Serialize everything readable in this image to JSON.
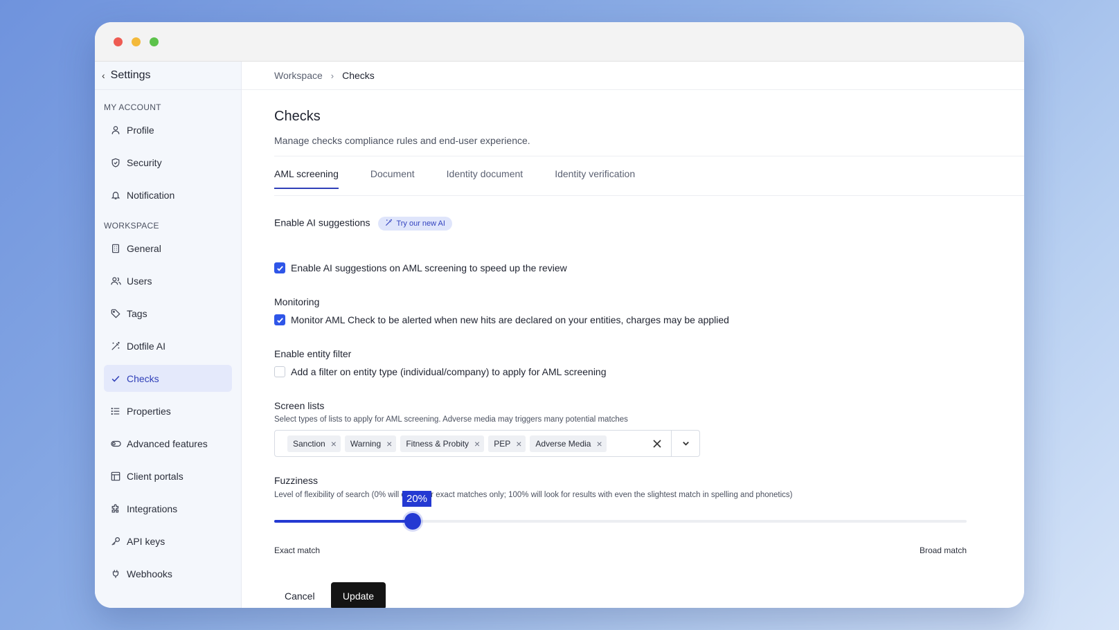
{
  "sidebar": {
    "back_label": "Settings",
    "sections": [
      {
        "title": "MY ACCOUNT",
        "items": [
          {
            "label": "Profile",
            "icon": "user-icon"
          },
          {
            "label": "Security",
            "icon": "shield-icon"
          },
          {
            "label": "Notification",
            "icon": "bell-icon"
          }
        ]
      },
      {
        "title": "WORKSPACE",
        "items": [
          {
            "label": "General",
            "icon": "building-icon"
          },
          {
            "label": "Users",
            "icon": "users-icon"
          },
          {
            "label": "Tags",
            "icon": "tag-icon"
          },
          {
            "label": "Dotfile AI",
            "icon": "magic-wand-icon"
          },
          {
            "label": "Checks",
            "icon": "check-icon",
            "active": true
          },
          {
            "label": "Properties",
            "icon": "list-icon"
          },
          {
            "label": "Advanced features",
            "icon": "toggle-icon"
          },
          {
            "label": "Client portals",
            "icon": "layout-icon"
          },
          {
            "label": "Integrations",
            "icon": "puzzle-icon"
          },
          {
            "label": "API keys",
            "icon": "key-icon"
          },
          {
            "label": "Webhooks",
            "icon": "plug-icon"
          }
        ]
      }
    ]
  },
  "breadcrumb": {
    "parent": "Workspace",
    "current": "Checks"
  },
  "page": {
    "title": "Checks",
    "subtitle": "Manage checks compliance rules and end-user experience."
  },
  "tabs": [
    {
      "label": "AML screening",
      "active": true
    },
    {
      "label": "Document"
    },
    {
      "label": "Identity document"
    },
    {
      "label": "Identity verification"
    }
  ],
  "ai_suggestions": {
    "title": "Enable AI suggestions",
    "badge": "Try our new AI",
    "checkbox_label": "Enable AI suggestions on AML screening to speed up the review",
    "checked": true
  },
  "monitoring": {
    "title": "Monitoring",
    "checkbox_label": "Monitor AML Check to be alerted when new hits are declared on your entities, charges may be applied",
    "checked": true
  },
  "entity_filter": {
    "title": "Enable entity filter",
    "checkbox_label": "Add a filter on entity type (individual/company) to apply for AML screening",
    "checked": false
  },
  "screen_lists": {
    "title": "Screen lists",
    "hint": "Select types of lists to apply for AML screening. Adverse media may triggers many potential matches",
    "selected": [
      "Sanction",
      "Warning",
      "Fitness & Probity",
      "PEP",
      "Adverse Media"
    ]
  },
  "fuzziness": {
    "title": "Fuzziness",
    "hint": "Level of flexibility of search (0% will check for exact matches only; 100% will look for results with even the slightest match in spelling and phonetics)",
    "value_label": "20%",
    "value": 0.2,
    "min_label": "Exact match",
    "max_label": "Broad match"
  },
  "actions": {
    "cancel": "Cancel",
    "update": "Update"
  },
  "colors": {
    "accent": "#2439d2",
    "checkbox": "#2f56e8",
    "active_nav_bg": "#e4e9fb"
  }
}
